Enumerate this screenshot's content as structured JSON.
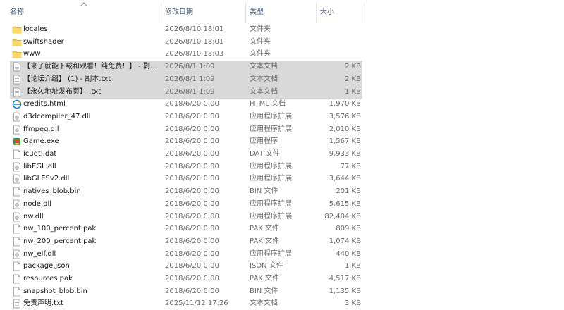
{
  "columns": {
    "name": "名称",
    "date": "修改日期",
    "type": "类型",
    "size": "大小"
  },
  "files": [
    {
      "name": "locales",
      "date": "2026/8/10 18:01",
      "type": "文件夹",
      "size": "",
      "icon": "folder-icon",
      "selected": false
    },
    {
      "name": "swiftshader",
      "date": "2026/8/10 18:01",
      "type": "文件夹",
      "size": "",
      "icon": "folder-icon",
      "selected": false
    },
    {
      "name": "www",
      "date": "2026/8/10 18:03",
      "type": "文件夹",
      "size": "",
      "icon": "folder-icon",
      "selected": false
    },
    {
      "name": "【来了就能下载和观看！纯免费！】 - 副...",
      "date": "2026/8/1 1:09",
      "type": "文本文档",
      "size": "2 KB",
      "icon": "text-file-icon",
      "selected": true
    },
    {
      "name": "【论坛介绍】 (1) - 副本.txt",
      "date": "2026/8/1 1:09",
      "type": "文本文档",
      "size": "2 KB",
      "icon": "text-file-icon",
      "selected": true
    },
    {
      "name": "【永久地址发布页】 .txt",
      "date": "2026/8/1 1:09",
      "type": "文本文档",
      "size": "1 KB",
      "icon": "text-file-icon",
      "selected": true
    },
    {
      "name": "credits.html",
      "date": "2018/6/20 0:00",
      "type": "HTML 文档",
      "size": "1,970 KB",
      "icon": "html-file-icon",
      "selected": false
    },
    {
      "name": "d3dcompiler_47.dll",
      "date": "2018/6/20 0:00",
      "type": "应用程序扩展",
      "size": "3,576 KB",
      "icon": "dll-file-icon",
      "selected": false
    },
    {
      "name": "ffmpeg.dll",
      "date": "2018/6/20 0:00",
      "type": "应用程序扩展",
      "size": "2,010 KB",
      "icon": "dll-file-icon",
      "selected": false
    },
    {
      "name": "Game.exe",
      "date": "2018/6/20 0:00",
      "type": "应用程序",
      "size": "1,567 KB",
      "icon": "game-exe-icon",
      "selected": false
    },
    {
      "name": "icudtl.dat",
      "date": "2018/6/20 0:00",
      "type": "DAT 文件",
      "size": "9,933 KB",
      "icon": "blank-file-icon",
      "selected": false
    },
    {
      "name": "libEGL.dll",
      "date": "2018/6/20 0:00",
      "type": "应用程序扩展",
      "size": "77 KB",
      "icon": "dll-file-icon",
      "selected": false
    },
    {
      "name": "libGLESv2.dll",
      "date": "2018/6/20 0:00",
      "type": "应用程序扩展",
      "size": "3,644 KB",
      "icon": "dll-file-icon",
      "selected": false
    },
    {
      "name": "natives_blob.bin",
      "date": "2018/6/20 0:00",
      "type": "BIN 文件",
      "size": "201 KB",
      "icon": "blank-file-icon",
      "selected": false
    },
    {
      "name": "node.dll",
      "date": "2018/6/20 0:00",
      "type": "应用程序扩展",
      "size": "5,615 KB",
      "icon": "dll-file-icon",
      "selected": false
    },
    {
      "name": "nw.dll",
      "date": "2018/6/20 0:00",
      "type": "应用程序扩展",
      "size": "82,404 KB",
      "icon": "dll-file-icon",
      "selected": false
    },
    {
      "name": "nw_100_percent.pak",
      "date": "2018/6/20 0:00",
      "type": "PAK 文件",
      "size": "809 KB",
      "icon": "blank-file-icon",
      "selected": false
    },
    {
      "name": "nw_200_percent.pak",
      "date": "2018/6/20 0:00",
      "type": "PAK 文件",
      "size": "1,074 KB",
      "icon": "blank-file-icon",
      "selected": false
    },
    {
      "name": "nw_elf.dll",
      "date": "2018/6/20 0:00",
      "type": "应用程序扩展",
      "size": "440 KB",
      "icon": "dll-file-icon",
      "selected": false
    },
    {
      "name": "package.json",
      "date": "2018/6/20 0:00",
      "type": "JSON 文件",
      "size": "1 KB",
      "icon": "blank-file-icon",
      "selected": false
    },
    {
      "name": "resources.pak",
      "date": "2018/6/20 0:00",
      "type": "PAK 文件",
      "size": "4,517 KB",
      "icon": "blank-file-icon",
      "selected": false
    },
    {
      "name": "snapshot_blob.bin",
      "date": "2018/6/20 0:00",
      "type": "BIN 文件",
      "size": "1,135 KB",
      "icon": "blank-file-icon",
      "selected": false
    },
    {
      "name": "免责声明.txt",
      "date": "2025/11/12 17:26",
      "type": "文本文档",
      "size": "3 KB",
      "icon": "text-file-icon",
      "selected": false
    }
  ],
  "colors": {
    "selection": "#d9d9d9",
    "header_text": "#4c607a",
    "folder": "#f5c74b"
  }
}
